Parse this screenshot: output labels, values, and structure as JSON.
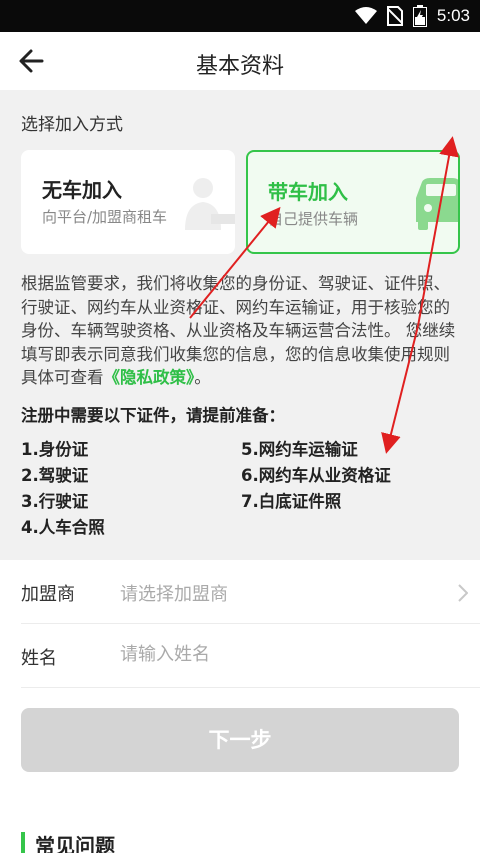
{
  "status_bar": {
    "time": "5:03",
    "icons": [
      "wifi-icon",
      "no-sim-icon",
      "battery-icon"
    ]
  },
  "header": {
    "title": "基本资料",
    "back_icon": "arrow-left-icon"
  },
  "join_section": {
    "label": "选择加入方式",
    "options": [
      {
        "title": "无车加入",
        "subtitle": "向平台/加盟商租车",
        "icon": "person-key-icon",
        "selected": false
      },
      {
        "title": "带车加入",
        "subtitle": "自己提供车辆",
        "icon": "car-icon",
        "selected": true
      }
    ]
  },
  "description": {
    "text": "根据监管要求，我们将收集您的身份证、驾驶证、证件照、行驶证、网约车从业资格证、网约车运输证，用于核验您的身份、车辆驾驶资格、从业资格及车辆运营合法性。 您继续填写即表示同意我们收集您的信息，您的信息收集使用规则具体可查看",
    "link": "《隐私政策》",
    "suffix": "。"
  },
  "requirements": {
    "title": "注册中需要以下证件，请提前准备：",
    "items": [
      "1.身份证",
      "2.驾驶证",
      "3.行驶证",
      "4.人车合照",
      "5.网约车运输证",
      "6.网约车从业资格证",
      "7.白底证件照"
    ]
  },
  "form": {
    "franchise": {
      "label": "加盟商",
      "placeholder": "请选择加盟商"
    },
    "name": {
      "label": "姓名",
      "placeholder": "请输入姓名"
    }
  },
  "next_button": "下一步",
  "faq": {
    "title": "常见问题"
  },
  "colors": {
    "accent": "#35c54a",
    "annotation": "#e02020",
    "button_disabled": "#d4d4d4"
  }
}
